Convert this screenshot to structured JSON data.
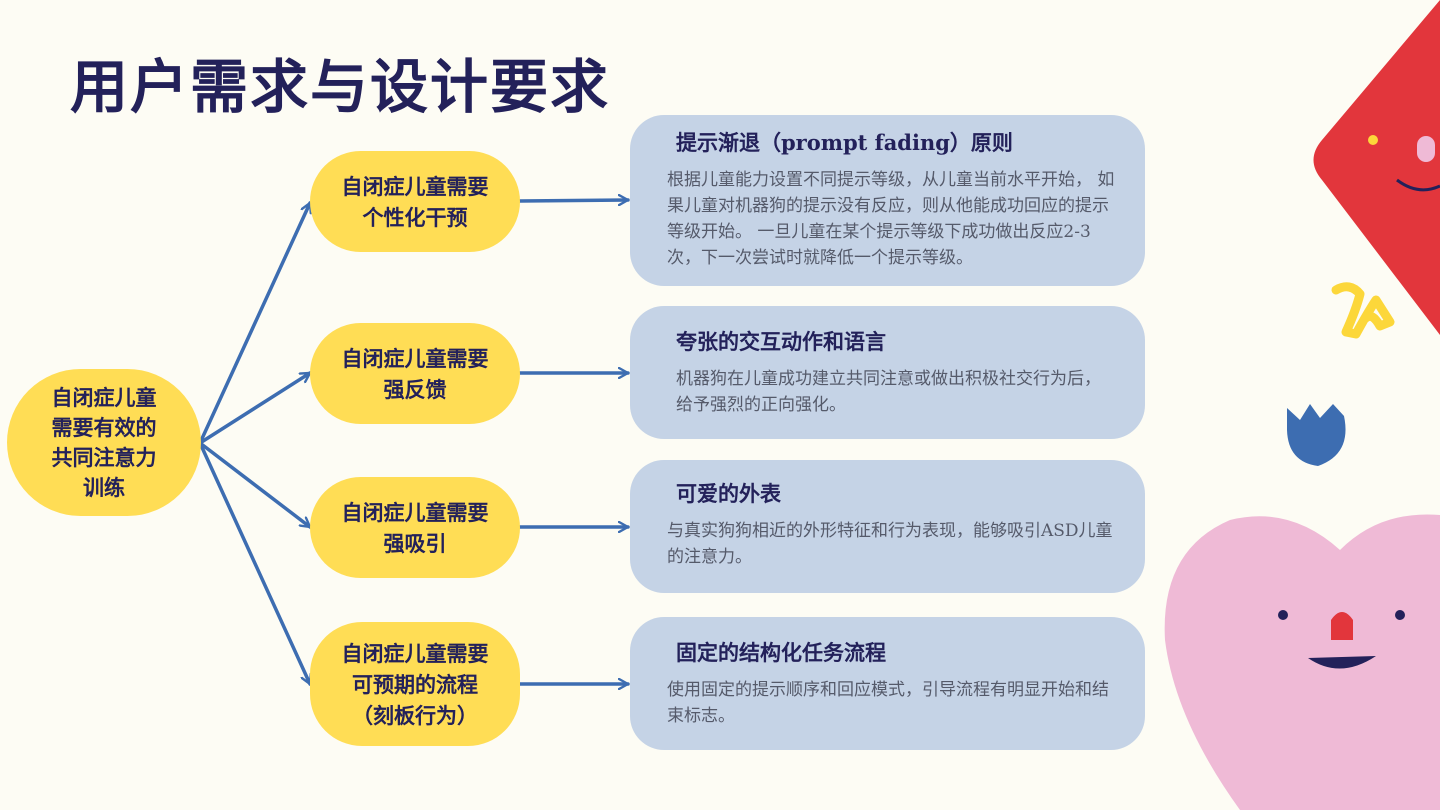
{
  "title": "用户需求与设计要求",
  "root": "自闭症儿童需要有效的共同注意力训练",
  "needs": [
    "自闭症儿童需要\n个性化干预",
    "自闭症儿童需要\n强反馈",
    "自闭症儿童需要\n强吸引",
    "自闭症儿童需要\n可预期的流程\n（刻板行为）"
  ],
  "cards": [
    {
      "title": "提示渐退（prompt fading）原则",
      "body": "根据儿童能力设置不同提示等级，从儿童当前水平开始， 如果儿童对机器狗的提示没有反应，则从他能成功回应的提示等级开始。 一旦儿童在某个提示等级下成功做出反应2-3次，下一次尝试时就降低一个提示等级。"
    },
    {
      "title": "夸张的交互动作和语言",
      "body": "机器狗在儿童成功建立共同注意或做出积极社交行为后，给予强烈的正向强化。"
    },
    {
      "title": "可爱的外表",
      "body": "与真实狗狗相近的外形特征和行为表现，能够吸引ASD儿童的注意力。"
    },
    {
      "title": "固定的结构化任务流程",
      "body": "使用固定的提示顺序和回应模式，引导流程有明显开始和结束标志。"
    }
  ],
  "colors": {
    "background": "#fdfcf4",
    "title": "#23215a",
    "node_fill": "#ffdd55",
    "card_fill": "#c5d3e6",
    "arrow": "#3d6db1",
    "deco_red": "#e2363c",
    "deco_pink": "#efbad6",
    "deco_blue": "#3d6db1",
    "deco_yellow": "#fcd73a"
  }
}
